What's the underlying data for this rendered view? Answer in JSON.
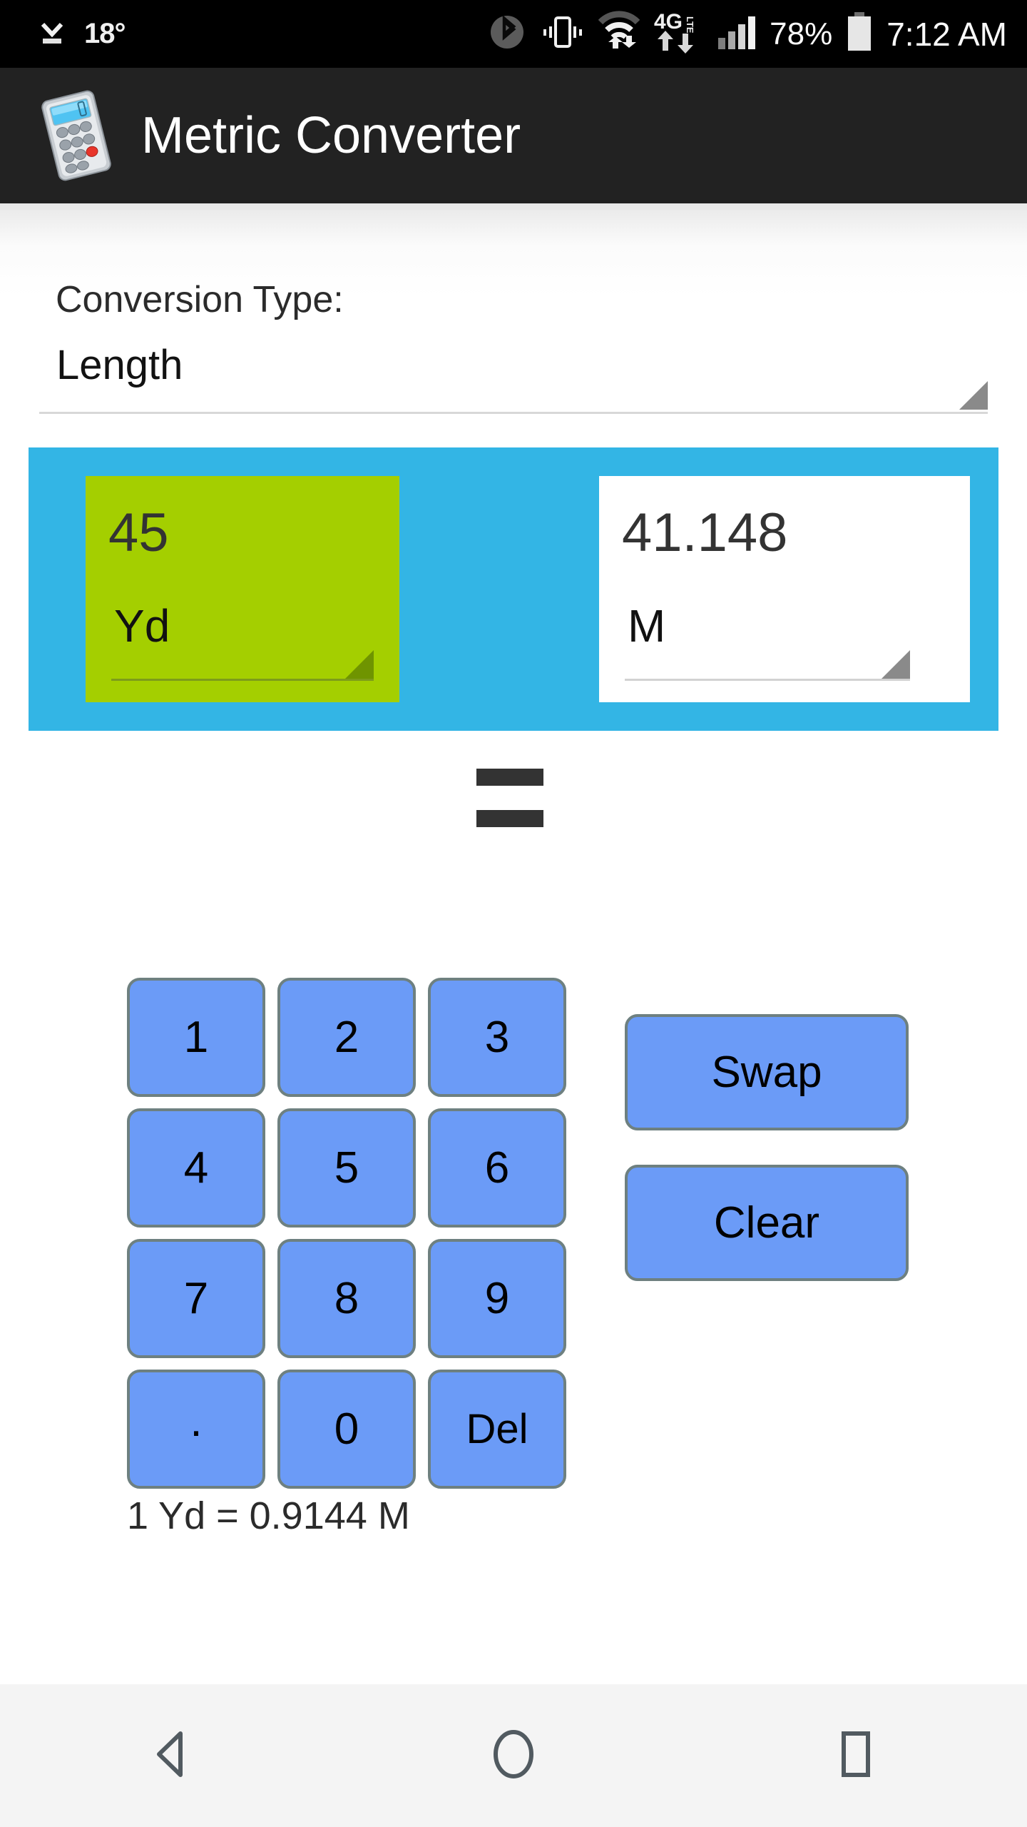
{
  "status_bar": {
    "download_icon": "download-icon",
    "temperature": "18°",
    "bluetooth_icon": "bluetooth-icon",
    "vibrate_icon": "vibrate-icon",
    "wifi_icon": "wifi-icon",
    "network_icon": "4g-lte-icon",
    "signal_icon": "signal-bars-icon",
    "battery_percent": "78%",
    "battery_icon": "battery-icon",
    "time": "7:12 AM"
  },
  "app_bar": {
    "icon": "calculator-icon",
    "title": "Metric Converter"
  },
  "conversion_type": {
    "label": "Conversion Type:",
    "value": "Length",
    "dropdown_icon": "dropdown-triangle-icon"
  },
  "converter": {
    "input": {
      "value": "45",
      "unit": "Yd",
      "dropdown_icon": "dropdown-triangle-icon"
    },
    "equals_icon": "equals-icon",
    "output": {
      "value": "41.148",
      "unit": "M",
      "dropdown_icon": "dropdown-triangle-icon"
    }
  },
  "keypad": {
    "keys": [
      {
        "label": "1",
        "name": "key-1"
      },
      {
        "label": "2",
        "name": "key-2"
      },
      {
        "label": "3",
        "name": "key-3"
      },
      {
        "label": "4",
        "name": "key-4"
      },
      {
        "label": "5",
        "name": "key-5"
      },
      {
        "label": "6",
        "name": "key-6"
      },
      {
        "label": "7",
        "name": "key-7"
      },
      {
        "label": "8",
        "name": "key-8"
      },
      {
        "label": "9",
        "name": "key-9"
      },
      {
        "label": ".",
        "name": "key-decimal"
      },
      {
        "label": "0",
        "name": "key-0"
      },
      {
        "label": "Del",
        "name": "key-delete"
      }
    ]
  },
  "actions": {
    "swap_label": "Swap",
    "clear_label": "Clear"
  },
  "formula": "1 Yd = 0.9144 M",
  "nav_bar": {
    "back_icon": "back-triangle-icon",
    "home_icon": "home-circle-icon",
    "recents_icon": "recents-square-icon"
  },
  "colors": {
    "status_bar_bg": "#000000",
    "app_bar_bg": "#222222",
    "panel_blue": "#33b5e5",
    "input_green": "#a4cf00",
    "key_blue": "#6b9bf7",
    "key_border": "#6e8080",
    "nav_bg": "#f4f4f4"
  }
}
